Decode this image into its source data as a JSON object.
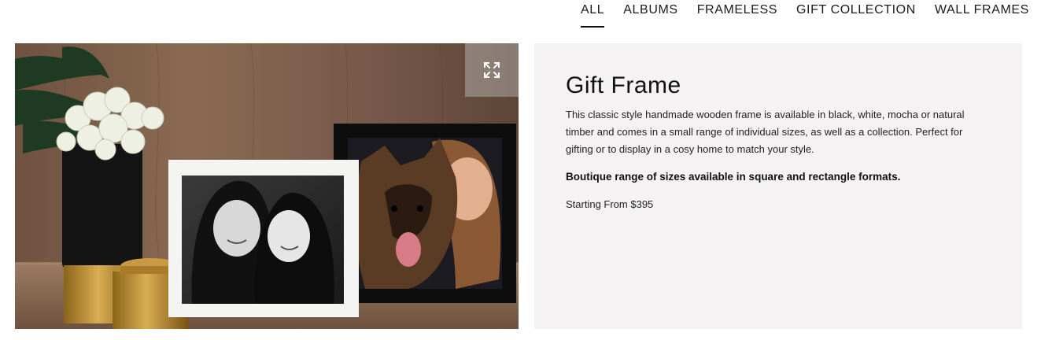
{
  "nav": {
    "tabs": [
      {
        "label": "ALL",
        "active": true
      },
      {
        "label": "ALBUMS",
        "active": false
      },
      {
        "label": "FRAMELESS",
        "active": false
      },
      {
        "label": "GIFT COLLECTION",
        "active": false
      },
      {
        "label": "WALL FRAMES",
        "active": false
      }
    ]
  },
  "photo": {
    "expand_icon": "expand-arrows-icon"
  },
  "product": {
    "title": "Gift Frame",
    "description": "This classic style handmade wooden frame is available in black, white, mocha or natural timber and comes in a small range of individual sizes, as well as a collection. Perfect for gifting or to display in a cosy home to match your style.",
    "highlight": "Boutique range of sizes available in square and rectangle formats.",
    "price": "Starting From $395"
  },
  "colors": {
    "panel_bg": "#f4f2f3",
    "text": "#111111"
  }
}
